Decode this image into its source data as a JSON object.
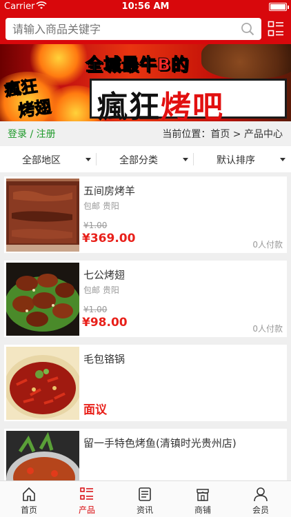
{
  "status_bar": {
    "carrier": "Carrier",
    "time": "10:56 AM"
  },
  "search": {
    "placeholder": "请输入商品关键字"
  },
  "banner": {
    "line1_pre": "全城最牛",
    "line1_em": "B",
    "line1_post": "的",
    "line2_pre": "瘋狂",
    "line2_em": "烤吧",
    "corner_top": "瘋狂",
    "corner_bottom": "烤翅"
  },
  "location": {
    "login": "登录 / 注册",
    "breadcrumb": "当前位置：首页 > 产品中心"
  },
  "filters": [
    {
      "label": "全部地区"
    },
    {
      "label": "全部分类"
    },
    {
      "label": "默认排序"
    }
  ],
  "products": [
    {
      "name": "五间房烤羊",
      "shipping": "包邮 贵阳",
      "old_price": "¥1.00",
      "price": "¥369.00",
      "paid": "0人付款"
    },
    {
      "name": "七公烤翅",
      "shipping": "包邮 贵阳",
      "old_price": "¥1.00",
      "price": "¥98.00",
      "paid": "0人付款"
    },
    {
      "name": "毛包铬锅",
      "price_text": "面议"
    },
    {
      "name": "留一手特色烤鱼(清镇时光贵州店)"
    }
  ],
  "tabs": [
    {
      "label": "首页",
      "icon": "home-icon"
    },
    {
      "label": "产品",
      "icon": "list-icon"
    },
    {
      "label": "资讯",
      "icon": "news-icon"
    },
    {
      "label": "商铺",
      "icon": "store-icon"
    },
    {
      "label": "会员",
      "icon": "user-icon"
    }
  ],
  "colors": {
    "brand_red": "#d8080c",
    "price_red": "#e8201a",
    "login_green": "#1e9a2a"
  }
}
